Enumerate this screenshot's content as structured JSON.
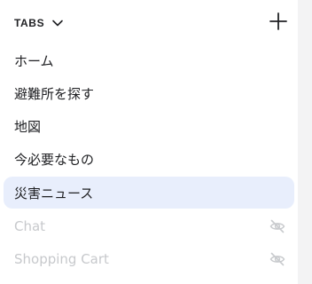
{
  "header": {
    "title": "TABS"
  },
  "tabs": [
    {
      "label": "ホーム",
      "state": "normal"
    },
    {
      "label": "避難所を探す",
      "state": "normal"
    },
    {
      "label": "地図",
      "state": "normal"
    },
    {
      "label": "今必要なもの",
      "state": "normal"
    },
    {
      "label": "災害ニュース",
      "state": "active"
    },
    {
      "label": "Chat",
      "state": "hidden"
    },
    {
      "label": "Shopping Cart",
      "state": "hidden"
    }
  ],
  "icons": {
    "tabs_chevron": "chevron-down-icon",
    "add": "plus-icon",
    "hidden_indicator": "eye-off-icon"
  },
  "colors": {
    "active_background": "#e8eefc",
    "text": "#202124",
    "hidden_text": "#c7c9cc",
    "scrollbar_track": "#f3f3f4"
  }
}
